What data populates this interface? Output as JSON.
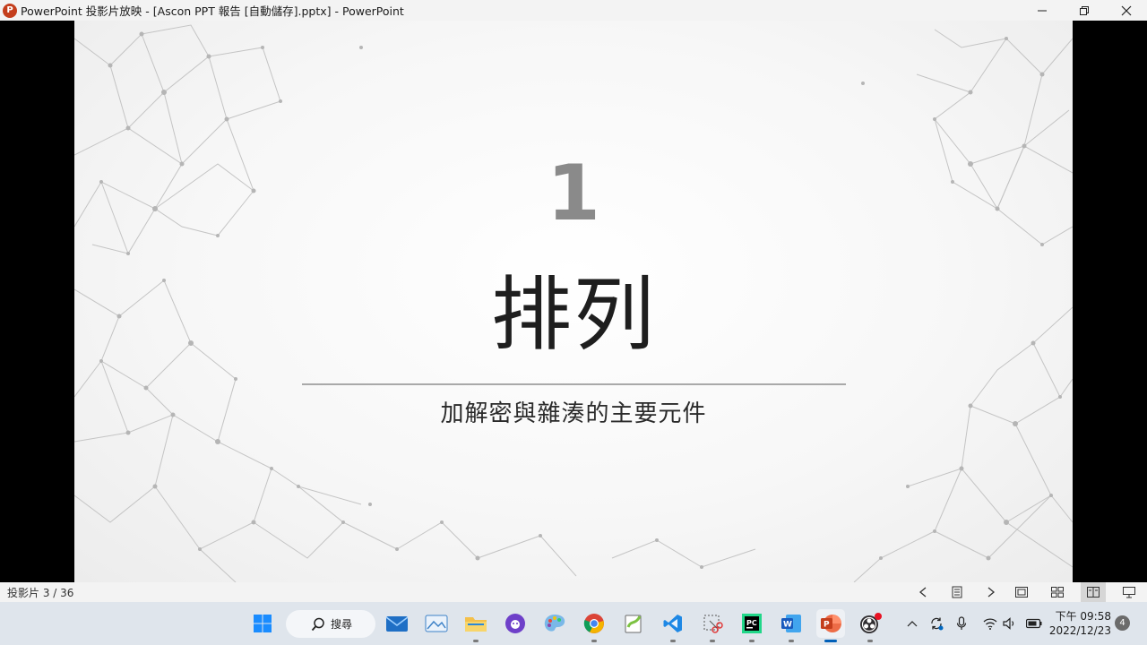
{
  "window": {
    "title": "PowerPoint 投影片放映 - [Ascon PPT 報告 [自動儲存].pptx] - PowerPoint",
    "app_icon_letter": "P",
    "icon_color": "#c43e1c"
  },
  "slide": {
    "number": "1",
    "title": "排列",
    "subtitle": "加解密與雜湊的主要元件"
  },
  "statusbar": {
    "slide_counter": "投影片 3 / 36"
  },
  "taskbar": {
    "search_label": "搜尋",
    "apps": [
      "start-icon",
      "search",
      "mail-icon",
      "photos-icon",
      "file-explorer-icon",
      "github-desktop-icon",
      "paint-icon",
      "chrome-icon",
      "notepadpp-icon",
      "vscode-icon",
      "snipping-tool-icon",
      "pycharm-icon",
      "word-icon",
      "powerpoint-icon",
      "obs-icon"
    ],
    "clock_time": "下午 09:58",
    "clock_date": "2022/12/23",
    "notification_count": "4"
  }
}
